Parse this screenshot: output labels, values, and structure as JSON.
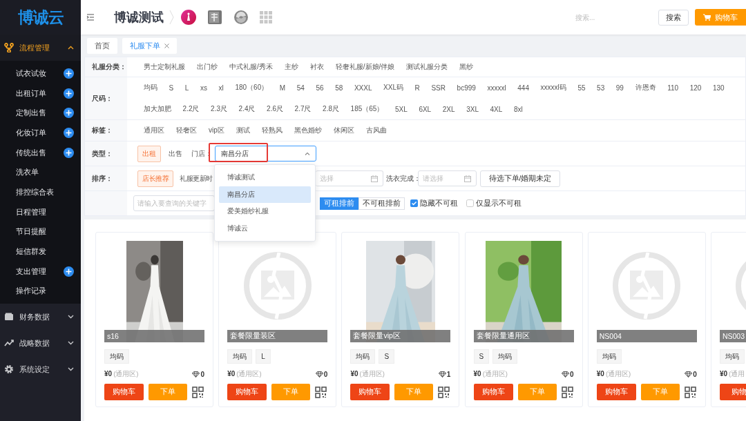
{
  "sidebar": {
    "logo": "博诚云",
    "groups": [
      {
        "label": "流程管理",
        "expanded": true,
        "items": [
          {
            "label": "试衣试妆",
            "addable": true
          },
          {
            "label": "出租订单",
            "addable": true
          },
          {
            "label": "定制出售",
            "addable": true
          },
          {
            "label": "化妆订单",
            "addable": true
          },
          {
            "label": "传统出售",
            "addable": true
          },
          {
            "label": "洗衣单",
            "addable": false
          },
          {
            "label": "排控综合表",
            "addable": false
          },
          {
            "label": "日程管理",
            "addable": false
          },
          {
            "label": "节日提醒",
            "addable": false
          },
          {
            "label": "短信群发",
            "addable": false
          },
          {
            "label": "支出管理",
            "addable": true
          },
          {
            "label": "操作记录",
            "addable": false
          }
        ]
      },
      {
        "label": "财务数据",
        "expanded": false
      },
      {
        "label": "战略数据",
        "expanded": false
      },
      {
        "label": "系统设定",
        "expanded": false
      }
    ]
  },
  "header": {
    "title": "博诚测试",
    "search": {
      "placeholder": "搜索..."
    },
    "search_button": "搜索",
    "cart_button": "购物车"
  },
  "tabs": [
    {
      "label": "首页",
      "selected": false,
      "closable": false
    },
    {
      "label": "礼服下单",
      "selected": true,
      "closable": true
    }
  ],
  "filters": {
    "category": {
      "label": "礼服分类：",
      "options": [
        "男士定制礼服",
        "出门纱",
        "中式礼服/秀禾",
        "主纱",
        "衬衣",
        "轻奢礼服/新娘/伴娘",
        "测试礼服分类",
        "黑纱"
      ]
    },
    "size": {
      "label": "尺码：",
      "lines": [
        [
          "均码",
          "S",
          "L",
          "xs",
          "xl",
          "180（60）",
          "M",
          "54",
          "56",
          "58",
          "XXXL",
          "XXL码",
          "R",
          "SSR",
          "bc999",
          "xxxxxl",
          "444",
          "xxxxxl码",
          "55",
          "53",
          "99",
          "许恩奇",
          "110",
          "120",
          "130"
        ],
        [
          "加大加肥",
          "2.2尺",
          "2.3尺",
          "2.4尺",
          "2.6尺",
          "2.7尺",
          "2.8尺",
          "185（65）",
          "5XL",
          "6XL",
          "2XL",
          "3XL",
          "4XL",
          "8xl"
        ]
      ]
    },
    "tag": {
      "label": "标签：",
      "options": [
        "通用区",
        "轻奢区",
        "vip区",
        "测试",
        "轻熟风",
        "黑色婚纱",
        "休闲区",
        "古风曲"
      ]
    },
    "type": {
      "label": "类型：",
      "options": [
        {
          "label": "出租",
          "selected": true
        },
        {
          "label": "出售",
          "selected": false
        }
      ],
      "store_label": "门店：",
      "store": {
        "value": "南昌分店",
        "open": true,
        "options": [
          {
            "label": "博诚测试",
            "selected": false
          },
          {
            "label": "南昌分店",
            "selected": true
          },
          {
            "label": "爱美婚纱礼服",
            "selected": false
          },
          {
            "label": "博诚云",
            "selected": false
          }
        ]
      }
    },
    "sort": {
      "label": "排序：",
      "options": [
        {
          "label": "店长推荐",
          "selected": true
        },
        {
          "label": "礼服更新时",
          "selected": false
        }
      ],
      "date_placeholder": "选择",
      "wash_label": "洗衣完成：",
      "wash_placeholder": "请选择",
      "pending_button": "待选下单/婚期未定"
    },
    "query": {
      "placeholder": "请输入要查询的关键字",
      "order": [
        {
          "label": "可租排前",
          "selected": true
        },
        {
          "label": "不可租排前",
          "selected": false
        }
      ],
      "checks": [
        {
          "label": "隐藏不可租",
          "checked": true
        },
        {
          "label": "仅显示不可租",
          "checked": false
        }
      ]
    }
  },
  "products": [
    {
      "title": "s16",
      "sizes": [
        "均码"
      ],
      "price": "¥0",
      "zone": "(通用区)",
      "gems": "0",
      "cart_button": "购物车",
      "order_button": "下单"
    },
    {
      "title": "套餐限量装区",
      "kind": "placeholder",
      "sizes": [
        "均码",
        "L"
      ],
      "price": "¥0",
      "zone": "(通用区)",
      "gems": "0",
      "cart_button": "购物车",
      "order_button": "下单"
    },
    {
      "title": "套餐限量vip区",
      "sizes": [
        "均码",
        "S"
      ],
      "price": "¥0",
      "zone": "(通用区)",
      "gems": "1",
      "cart_button": "购物车",
      "order_button": "下单"
    },
    {
      "title": "套餐限量通用区",
      "sizes": [
        "S",
        "均码"
      ],
      "price": "¥0",
      "zone": "(通用区)",
      "gems": "0",
      "cart_button": "购物车",
      "order_button": "下单"
    },
    {
      "title": "NS004",
      "kind": "placeholder",
      "sizes": [
        "均码"
      ],
      "price": "¥0",
      "zone": "(通用区)",
      "gems": "0",
      "cart_button": "购物车",
      "order_button": "下单"
    },
    {
      "title": "NS003",
      "kind": "placeholder",
      "sizes": [
        "均码"
      ],
      "price": "¥0",
      "zone": "(通用",
      "cart_button": "购物"
    }
  ]
}
